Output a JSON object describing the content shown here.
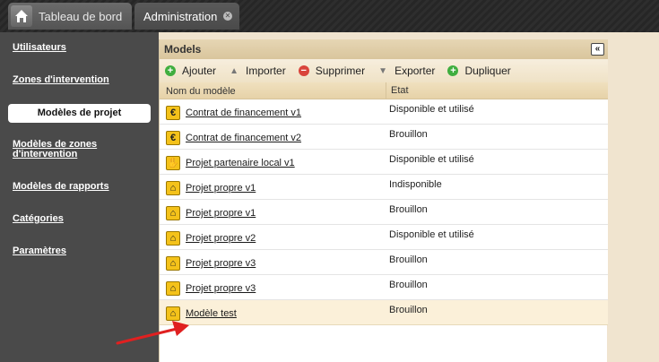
{
  "tabs": {
    "home_label": "Tableau de bord",
    "admin_label": "Administration"
  },
  "sidebar": {
    "items": [
      {
        "label": "Utilisateurs"
      },
      {
        "label": "Zones d'intervention"
      },
      {
        "label": "Modèles de projet",
        "active": true
      },
      {
        "label_line1": "Modèles de zones",
        "label_line2": "d'intervention"
      },
      {
        "label": "Modèles de rapports"
      },
      {
        "label": "Catégories"
      },
      {
        "label": "Paramètres"
      }
    ]
  },
  "panel": {
    "title": "Models",
    "collapse_glyph": "«",
    "toolbar": {
      "add": "Ajouter",
      "import": "Importer",
      "delete": "Supprimer",
      "export": "Exporter",
      "duplicate": "Dupliquer"
    },
    "columns": {
      "name": "Nom du modèle",
      "state": "Etat"
    },
    "rows": [
      {
        "icon": "euro-icon",
        "glyph": "€",
        "name": "Contrat de financement v1",
        "state": "Disponible et utilisé"
      },
      {
        "icon": "euro-icon",
        "glyph": "€",
        "name": "Contrat de financement v2",
        "state": "Brouillon"
      },
      {
        "icon": "handshake-icon",
        "glyph": "✋",
        "name": "Projet partenaire local v1",
        "state": "Disponible et utilisé"
      },
      {
        "icon": "house-icon",
        "glyph": "⌂",
        "name": "Projet propre v1",
        "state": "Indisponible"
      },
      {
        "icon": "house-icon",
        "glyph": "⌂",
        "name": "Projet propre v1",
        "state": "Brouillon"
      },
      {
        "icon": "house-icon",
        "glyph": "⌂",
        "name": "Projet propre v2",
        "state": "Disponible et utilisé"
      },
      {
        "icon": "house-icon",
        "glyph": "⌂",
        "name": "Projet propre v3",
        "state": "Brouillon"
      },
      {
        "icon": "house-icon",
        "glyph": "⌂",
        "name": "Projet propre v3",
        "state": "Brouillon"
      },
      {
        "icon": "house-icon",
        "glyph": "⌂",
        "name": "Modèle test",
        "state": "Brouillon",
        "selected": true
      }
    ]
  },
  "colors": {
    "sidebar_bg": "#4a4a4a",
    "panel_header": "#d9c59c",
    "selected_row": "#fbf0d9",
    "annotation_arrow": "#e02020",
    "row_icon_bg": "#f4c21a"
  }
}
